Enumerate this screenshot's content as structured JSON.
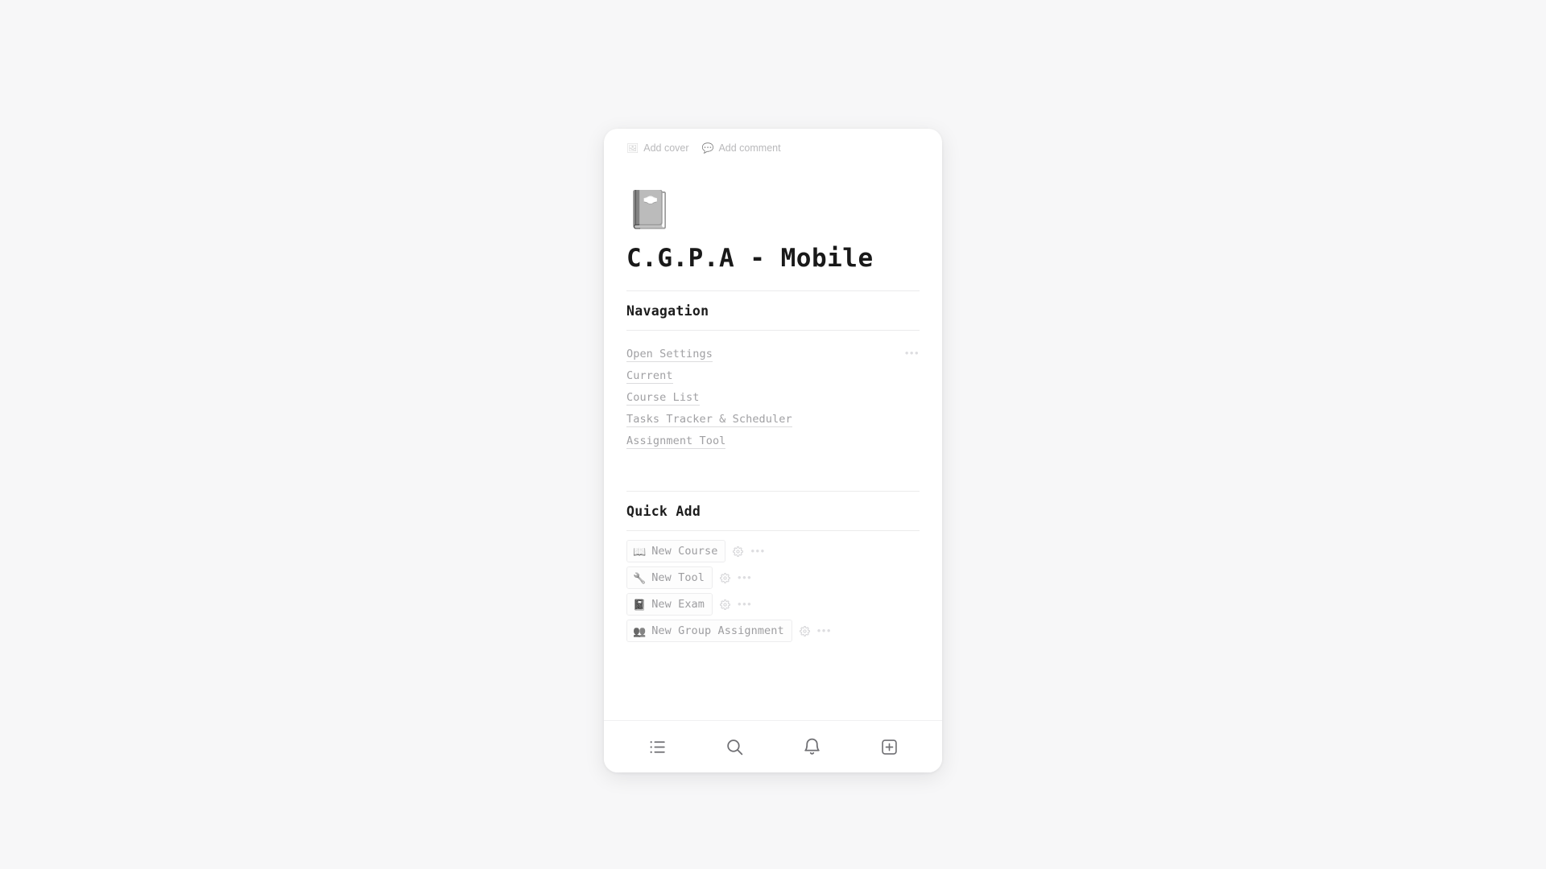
{
  "page": {
    "background_color": "#f7f7f8",
    "card_background": "#ffffff"
  },
  "top_actions": [
    {
      "icon": "image-icon",
      "glyph": "🖼",
      "label": "Add cover"
    },
    {
      "icon": "comment-icon",
      "glyph": "💬",
      "label": "Add comment"
    }
  ],
  "header": {
    "page_icon": "notebook-with-decorative-cover-icon",
    "page_icon_glyph": "📔",
    "title": "C.G.P.A - Mobile"
  },
  "navigation": {
    "heading": "Navagation",
    "row_menu_glyph": "•••",
    "links": [
      {
        "label": "Open Settings",
        "has_menu": true
      },
      {
        "label": "Current",
        "has_menu": false
      },
      {
        "label": "Course List",
        "has_menu": false
      },
      {
        "label": "Tasks Tracker & Scheduler",
        "has_menu": false
      },
      {
        "label": "Assignment Tool",
        "has_menu": false
      }
    ]
  },
  "quick_add": {
    "heading": "Quick Add",
    "gear_icon": "gear-icon",
    "menu_glyph": "•••",
    "items": [
      {
        "icon": "open-book-icon",
        "glyph": "📖",
        "label": "New Course"
      },
      {
        "icon": "wrench-icon",
        "glyph": "🔧",
        "label": "New Tool"
      },
      {
        "icon": "notebook-icon",
        "glyph": "📓",
        "label": "New Exam"
      },
      {
        "icon": "people-group-icon",
        "glyph": "👥",
        "label": "New Group Assignment"
      }
    ]
  },
  "bottom_bar": {
    "buttons": [
      {
        "icon": "list-icon",
        "name": "menu-list"
      },
      {
        "icon": "search-icon",
        "name": "search"
      },
      {
        "icon": "bell-icon",
        "name": "notifications"
      },
      {
        "icon": "plus-square-icon",
        "name": "create-new"
      }
    ]
  }
}
